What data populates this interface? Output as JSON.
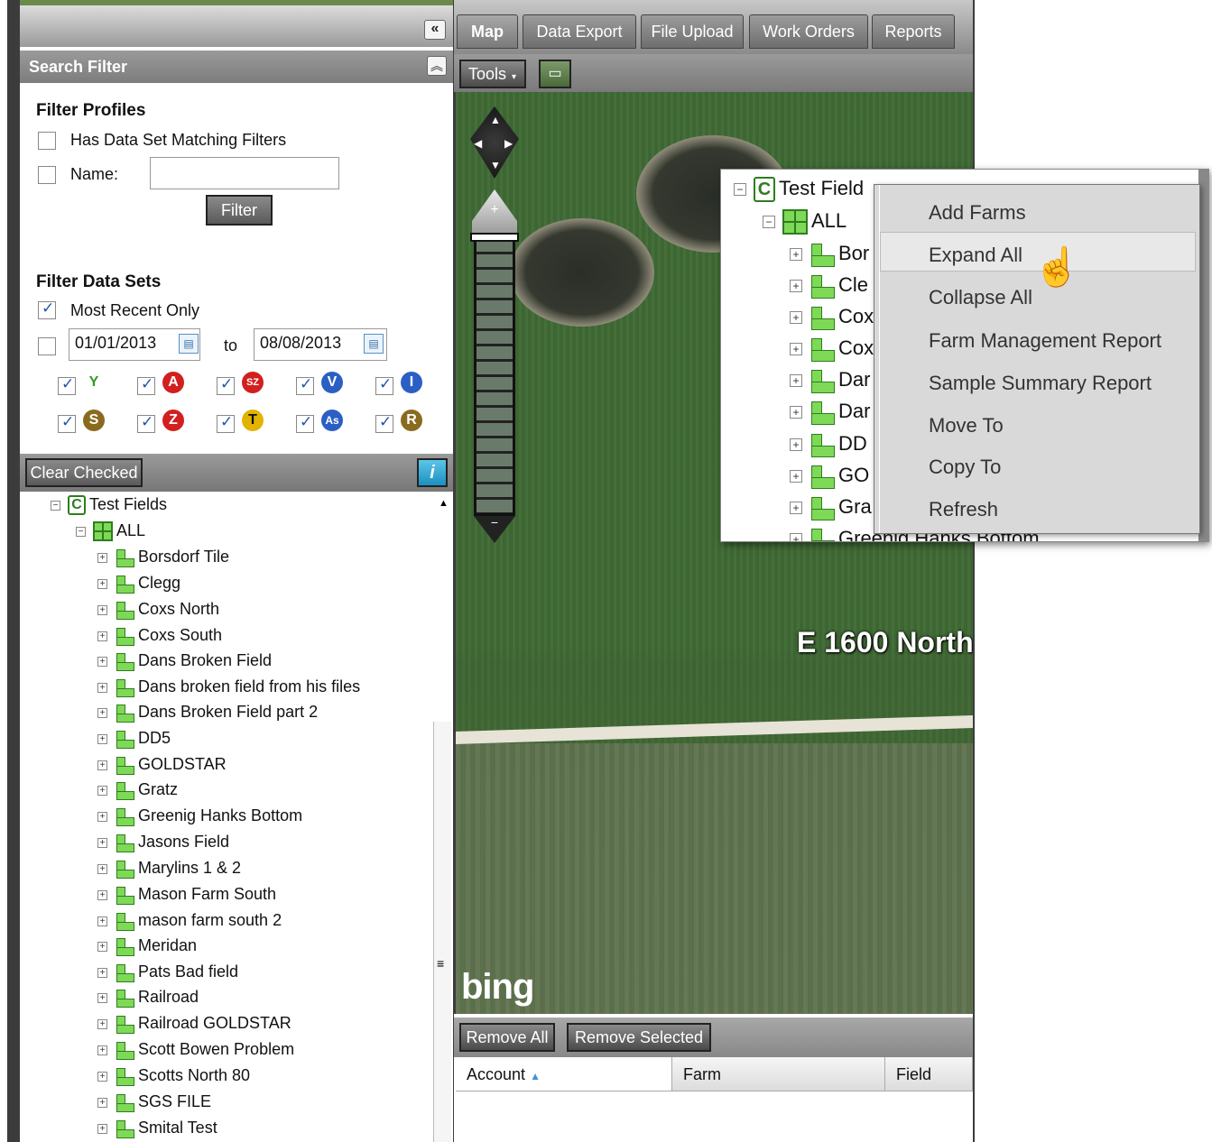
{
  "left_panel": {
    "collapse_icon": "double-chevron-left-icon",
    "search_filter_title": "Search Filter",
    "filter_profiles": {
      "title": "Filter Profiles",
      "has_data_set_label": "Has Data Set Matching Filters",
      "has_data_set_checked": false,
      "name_label": "Name:",
      "name_value": "",
      "filter_button": "Filter"
    },
    "filter_data_sets": {
      "title": "Filter Data Sets",
      "most_recent_label": "Most Recent Only",
      "most_recent_checked": true,
      "date_range_checked": false,
      "date_from": "01/01/2013",
      "date_to_label": "to",
      "date_to": "08/08/2013",
      "elements": [
        {
          "symbol": "Y",
          "color": "#2e9e1e",
          "checked": true
        },
        {
          "symbol": "A",
          "color": "#d21f1f",
          "checked": true
        },
        {
          "symbol": "SZ",
          "color": "#d21f1f",
          "checked": true
        },
        {
          "symbol": "V",
          "color": "#2b5fc4",
          "checked": true
        },
        {
          "symbol": "I",
          "color": "#2b5fc4",
          "checked": true
        },
        {
          "symbol": "S",
          "color": "#8a6a1e",
          "checked": true
        },
        {
          "symbol": "Z",
          "color": "#d21f1f",
          "checked": true
        },
        {
          "symbol": "T",
          "color": "#e0b400",
          "checked": true
        },
        {
          "symbol": "As",
          "color": "#2b5fc4",
          "checked": true
        },
        {
          "symbol": "R",
          "color": "#8a6a1e",
          "checked": true
        }
      ]
    },
    "clear_checked_button": "Clear Checked",
    "info_icon": "info-icon",
    "tree": {
      "root": "Test Fields",
      "root_icon_letter": "C",
      "group": "ALL",
      "fields": [
        "Borsdorf Tile",
        "Clegg",
        "Coxs North",
        "Coxs South",
        "Dans Broken Field",
        "Dans broken field from his files",
        "Dans Broken Field part 2",
        "DD5",
        "GOLDSTAR",
        "Gratz",
        "Greenig Hanks Bottom",
        "Jasons Field",
        "Marylins 1 & 2",
        "Mason Farm South",
        "mason farm south 2",
        "Meridan",
        "Pats Bad field",
        "Railroad",
        "Railroad GOLDSTAR",
        "Scott Bowen Problem",
        "Scotts North 80",
        "SGS FILE",
        "Smital Test"
      ]
    }
  },
  "tabs": [
    "Map",
    "Data Export",
    "File Upload",
    "Work Orders",
    "Reports"
  ],
  "active_tab": "Map",
  "toolbar": {
    "tools_label": "Tools",
    "print_icon": "print-icon"
  },
  "map": {
    "road_label": "E 1600 North",
    "provider_logo": "bing"
  },
  "results": {
    "remove_all": "Remove All",
    "remove_selected": "Remove Selected",
    "columns": [
      "Account",
      "Farm",
      "Field"
    ],
    "sort_icon": "sort-ascending-icon"
  },
  "popup_tree": {
    "root": "Test Field",
    "group": "ALL",
    "fields": [
      "Bor",
      "Cle",
      "Cox",
      "Cox",
      "Dar",
      "Dar",
      "DD",
      "GO",
      "Gra",
      "Greenig Hanks Bottom"
    ]
  },
  "context_menu": {
    "items": [
      "Add Farms",
      "Expand All",
      "Collapse All",
      "Farm Management Report",
      "Sample Summary Report",
      "Move To",
      "Copy To",
      "Refresh"
    ],
    "highlighted": "Expand All",
    "cursor_icon": "hand-pointer-icon"
  }
}
